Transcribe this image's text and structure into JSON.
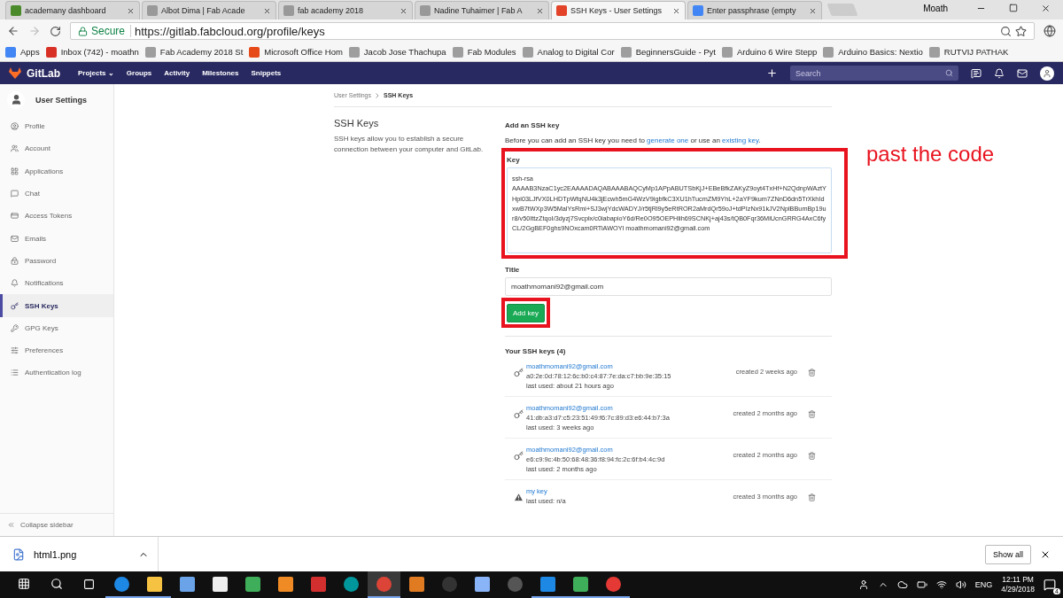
{
  "browser": {
    "tabs": [
      {
        "title": "academany dashboard",
        "selected": false
      },
      {
        "title": "Albot Dima | Fab Acade",
        "selected": false
      },
      {
        "title": "fab academy 2018",
        "selected": false
      },
      {
        "title": "Nadine Tuhaimer | Fab A",
        "selected": false
      },
      {
        "title": "SSH Keys - User Settings",
        "selected": true
      },
      {
        "title": "Enter passphrase (empty",
        "selected": false
      }
    ],
    "user": "Moath",
    "secure_label": "Secure",
    "url": "https://gitlab.fabcloud.org/profile/keys",
    "bookmarks": [
      "Apps",
      "Inbox (742) - moathn",
      "Fab Academy 2018 St",
      "Microsoft Office Hom",
      "Jacob Jose Thachupa",
      "Fab Modules",
      "Analog to Digital Cor",
      "BeginnersGuide - Pyt",
      "Arduino 6 Wire Stepp",
      "Arduino Basics: Nextio",
      "RUTVIJ PATHAK"
    ]
  },
  "navbar": {
    "brand": "GitLab",
    "links": [
      "Projects ⌄",
      "Groups",
      "Activity",
      "Milestones",
      "Snippets"
    ],
    "search": {
      "placeholder": "Search"
    }
  },
  "sidebar": {
    "title": "User Settings",
    "items": [
      {
        "label": "Profile",
        "selected": false
      },
      {
        "label": "Account",
        "selected": false
      },
      {
        "label": "Applications",
        "selected": false
      },
      {
        "label": "Chat",
        "selected": false
      },
      {
        "label": "Access Tokens",
        "selected": false
      },
      {
        "label": "Emails",
        "selected": false
      },
      {
        "label": "Password",
        "selected": false
      },
      {
        "label": "Notifications",
        "selected": false
      },
      {
        "label": "SSH Keys",
        "selected": true
      },
      {
        "label": "GPG Keys",
        "selected": false
      },
      {
        "label": "Preferences",
        "selected": false
      },
      {
        "label": "Authentication log",
        "selected": false
      }
    ],
    "collapse": "Collapse sidebar"
  },
  "breadcrumb": [
    "User Settings",
    "SSH Keys"
  ],
  "section": {
    "title": "SSH Keys",
    "description": "SSH keys allow you to establish a secure connection between your computer and GitLab."
  },
  "form": {
    "title": "Add an SSH key",
    "intro": [
      "Before you can add an SSH key you need to ",
      "generate one",
      " or use an ",
      "existing key",
      "."
    ],
    "key_label": "Key",
    "key_value": "ssh-rsa AAAAB3NzaC1yc2EAAAADAQABAAABAQCyMp1APpABUTSbKjJ+EBeBfkZAKyZ9oyt4TxHf+N2QdnpWAztYHpi03LJfVX0LHDTpWfqNU4k3jEcwh5mG4WzV9igbfkC3XU1hTucmZM9YhL+2aYF9kum7ZNnD6dn5TrXkhIdxwB7tWXp3W5MalYsRmi+SJ3wjYdcWADYJ/r5tjRl9y5eRtROR2aMrdQr59oJ+tdPIzNx91kJV2NplBBumBp19ur8/v50IttzZtqoI/3dyzj7Svcplx/c0iabapioY6d/Re0O95OEPHlih69SCNKj+aj43s/tQB0Fqr36MiUcnGRRG4AxC6fyCL/2GgBEF0ghs9NOxcam0RTiAWOYl moathmomani92@gmail.com",
    "title_label": "Title",
    "title_value": "moathmomani92@gmail.com",
    "button": "Add key",
    "annotation": "past the code"
  },
  "keys": {
    "heading": "Your SSH keys (4)",
    "items": [
      {
        "kind": "key",
        "title": "moathmomani92@gmail.com",
        "fingerprint": "a0:2e:0d:78:12:6c:b0:c4:87:7e:da:c7:bb:9e:35:15",
        "last_used": "last used: about 21 hours ago",
        "created": "created 2 weeks ago"
      },
      {
        "kind": "key",
        "title": "moathmomani92@gmail.com",
        "fingerprint": "41:db:a3:d7:c5:23:51:49:f6:7c:89:d3:e6:44:b7:3a",
        "last_used": "last used: 3 weeks ago",
        "created": "created 2 months ago"
      },
      {
        "kind": "key",
        "title": "moathmomani92@gmail.com",
        "fingerprint": "e6:c9:9c:4b:50:68:48:36:f8:94:fc:2c:6f:b4:4c:9d",
        "last_used": "last used: 2 months ago",
        "created": "created 2 months ago"
      },
      {
        "kind": "warning",
        "title": "my key",
        "last_used": "last used: n/a",
        "created": "created 3 months ago"
      }
    ]
  },
  "downloads": {
    "file": "html1.png",
    "show_all": "Show all"
  },
  "taskbar": {
    "apps": [
      {
        "kind": "edge",
        "running": true
      },
      {
        "kind": "folder",
        "running": true
      },
      {
        "kind": "store",
        "running": false
      },
      {
        "kind": "mail",
        "running": false
      },
      {
        "kind": "diamond",
        "running": false
      },
      {
        "kind": "fusion",
        "running": false
      },
      {
        "kind": "solidworks",
        "running": false
      },
      {
        "kind": "arduino",
        "running": false
      },
      {
        "kind": "chrome",
        "running": true
      },
      {
        "kind": "eagle",
        "running": false
      },
      {
        "kind": "python",
        "running": false
      },
      {
        "kind": "paint",
        "running": false
      },
      {
        "kind": "dots",
        "running": false
      },
      {
        "kind": "brackets",
        "running": true
      },
      {
        "kind": "diamond",
        "running": true
      },
      {
        "kind": "cutter",
        "running": true
      }
    ],
    "language": "ENG",
    "time": "12:11 PM",
    "date": "4/29/2018",
    "notifications": "4"
  }
}
